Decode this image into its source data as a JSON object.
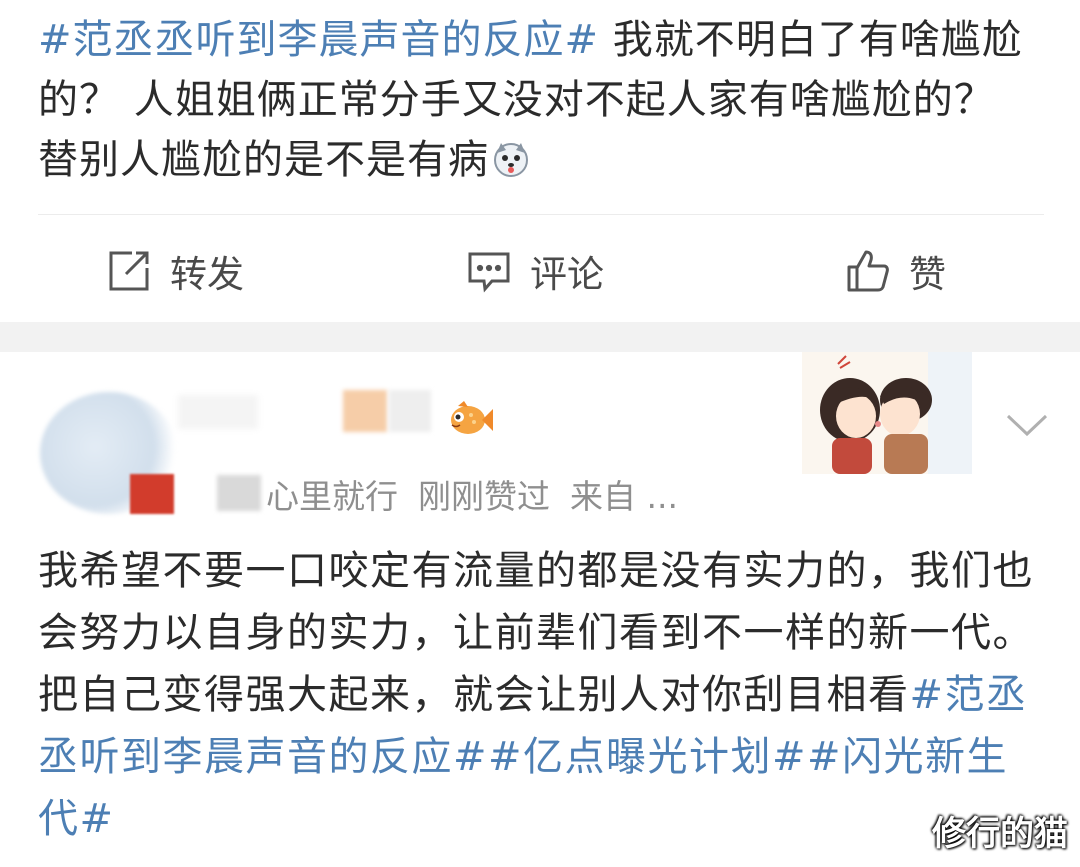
{
  "post1": {
    "hashtag": "#范丞丞听到李晨声音的反应#",
    "text": " 我就不明白了有啥尴尬的？ 人姐姐俩正常分手又没对不起人家有啥尴尬的？ 替别人尴尬的是不是有病"
  },
  "actions": {
    "repost_label": "转发",
    "comment_label": "评论",
    "like_label": "赞"
  },
  "post2": {
    "meta": {
      "source_fragment": "心里就行",
      "liked": "刚刚赞过",
      "from": "来自 ..."
    },
    "text_main": "我希望不要一口咬定有流量的都是没有实力的，我们也会努力以自身的实力，让前辈们看到不一样的新一代。把自己变得强大起来，就会让别人对你刮目相看",
    "hashtags": [
      "#范丞丞听到李晨声音的反应#",
      "#亿点曝光计划#",
      "#闪光新生代#"
    ]
  },
  "watermark": "修行的猫",
  "colors": {
    "hashtag": "#4d7fb4",
    "text": "#2b2b2b",
    "meta": "#8f8f8f",
    "band": "#f2f2f2"
  },
  "icons": [
    "repost-icon",
    "comment-icon",
    "like-icon",
    "dog-face-emoji",
    "fish-emoji",
    "chevron-down-icon"
  ]
}
